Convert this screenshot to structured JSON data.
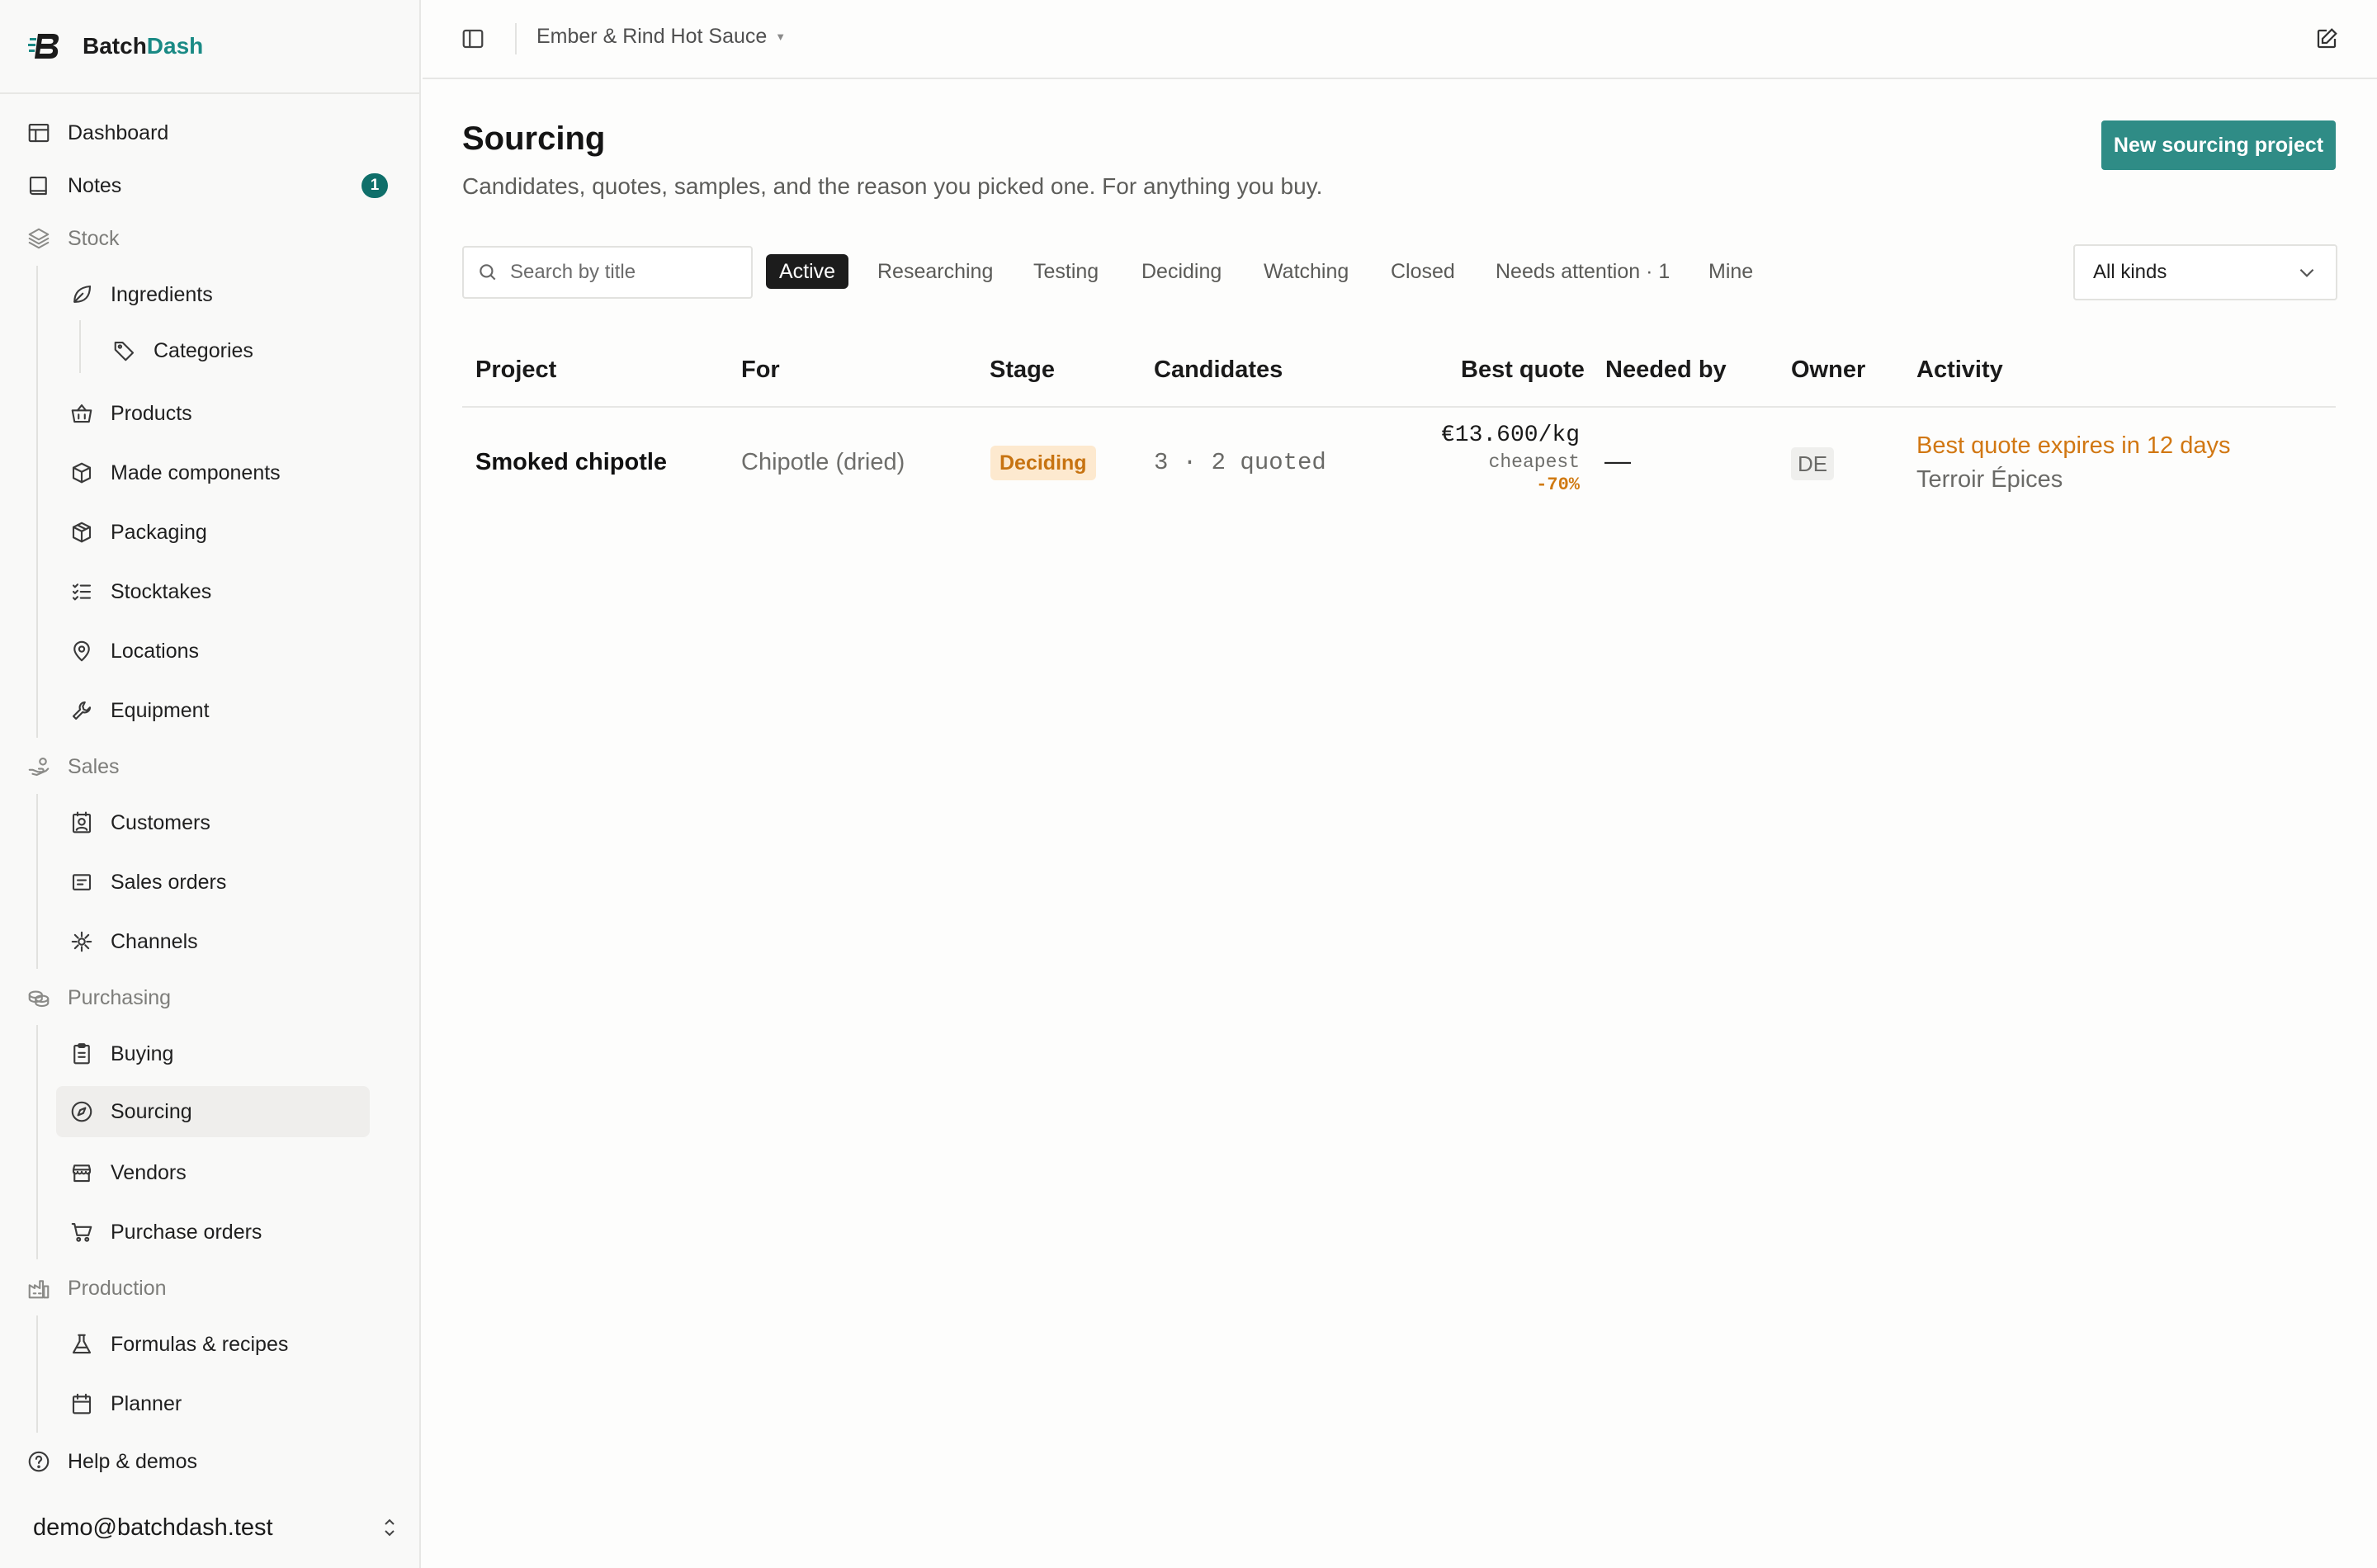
{
  "brand": {
    "name_part1": "Batch",
    "name_part2": "Dash"
  },
  "sidebar": {
    "dashboard": "Dashboard",
    "notes": {
      "label": "Notes",
      "badge": "1"
    },
    "stock": {
      "label": "Stock",
      "ingredients": "Ingredients",
      "categories": "Categories",
      "products": "Products",
      "made_components": "Made components",
      "packaging": "Packaging",
      "stocktakes": "Stocktakes",
      "locations": "Locations",
      "equipment": "Equipment"
    },
    "sales": {
      "label": "Sales",
      "customers": "Customers",
      "sales_orders": "Sales orders",
      "channels": "Channels"
    },
    "purchasing": {
      "label": "Purchasing",
      "buying": "Buying",
      "sourcing": "Sourcing",
      "vendors": "Vendors",
      "purchase_orders": "Purchase orders"
    },
    "production": {
      "label": "Production",
      "formulas": "Formulas & recipes",
      "planner": "Planner"
    },
    "help": "Help & demos",
    "user_email": "demo@batchdash.test"
  },
  "header": {
    "org_name": "Ember & Rind Hot Sauce"
  },
  "page": {
    "title": "Sourcing",
    "subtitle": "Candidates, quotes, samples, and the reason you picked one. For anything you buy.",
    "new_button": "New sourcing project"
  },
  "filters": {
    "search_placeholder": "Search by title",
    "tabs": [
      "Active",
      "Researching",
      "Testing",
      "Deciding",
      "Watching",
      "Closed",
      "Needs attention · 1",
      "Mine"
    ],
    "kind_select": "All kinds"
  },
  "table": {
    "columns": [
      "Project",
      "For",
      "Stage",
      "Candidates",
      "Best quote",
      "Needed by",
      "Owner",
      "Activity"
    ],
    "rows": [
      {
        "project": "Smoked chipotle",
        "for": "Chipotle (dried)",
        "stage": "Deciding",
        "candidates": "3 · 2 quoted",
        "best_quote": "€13.600/kg",
        "best_quote_note": "cheapest",
        "best_quote_delta": "-70%",
        "needed_by": "—",
        "owner": "DE",
        "activity_alert": "Best quote expires in 12 days",
        "activity_vendor": "Terroir Épices"
      }
    ]
  },
  "colors": {
    "accent": "#2f8c86",
    "badge": "#0f6f6a",
    "warning": "#d17712",
    "stage_bg": "#fde9cf"
  }
}
